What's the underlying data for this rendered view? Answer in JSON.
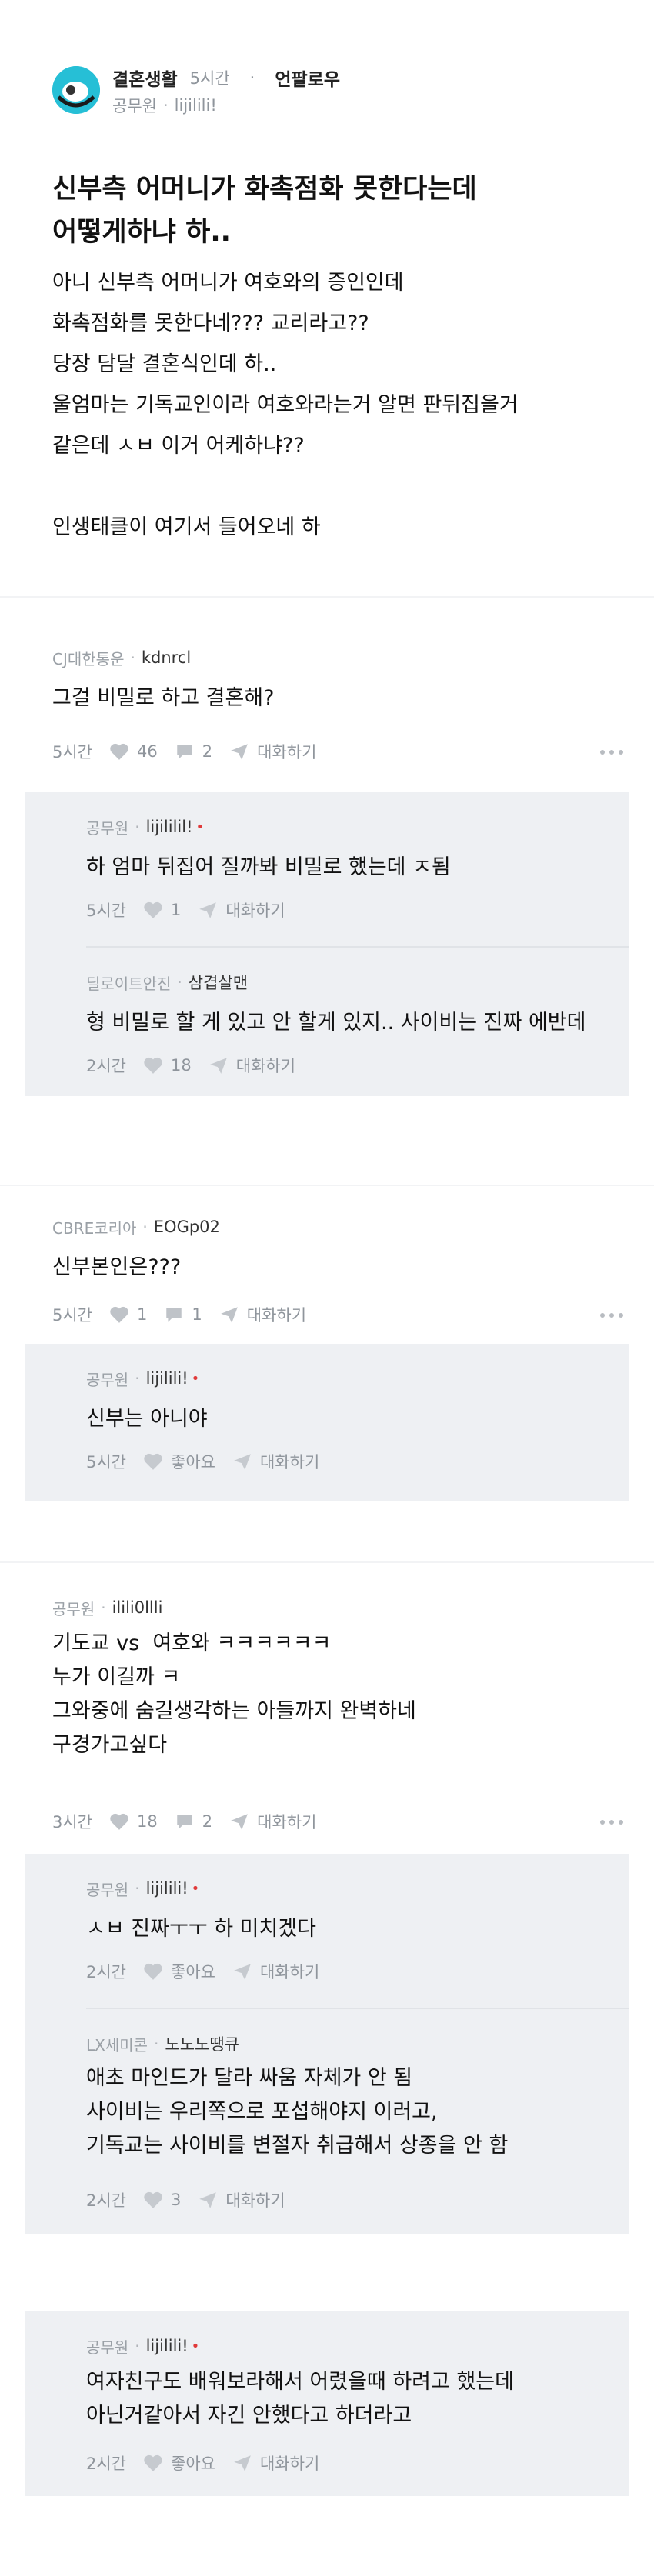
{
  "post": {
    "channel": "결혼생활",
    "time": "5시간",
    "follow_label": "언팔로우",
    "author_company": "공무원",
    "author_name": "lijilili!",
    "title_line1": "신부측 어머니가 화촉점화 못한다는데",
    "title_line2": "어떻게하냐 하..",
    "body_lines": [
      "아니 신부측 어머니가 여호와의 증인인데",
      "화촉점화를 못한다네??? 교리라고??",
      "당장 담달 결혼식인데 하..",
      "울엄마는 기독교인이라 여호와라는거 알면 판뒤집을거",
      "같은데 ㅅㅂ 이거 어케하냐??",
      "",
      "인생태클이 여기서 들어오네 하"
    ]
  },
  "comments": [
    {
      "company": "CJ대한통운",
      "name": "kdnrcl",
      "lines": [
        "그걸 비밀로 하고 결혼해?"
      ],
      "time": "5시간",
      "likes": "46",
      "replies": "2",
      "chat_label": "대화하기",
      "replies_list": [
        {
          "company": "공무원",
          "name": "lijililil!",
          "op": true,
          "lines": [
            "하 엄마 뒤집어 질까봐 비밀로 했는데 ㅈ됨"
          ],
          "time": "5시간",
          "likes": "1",
          "chat_label": "대화하기"
        },
        {
          "company": "딜로이트안진",
          "name": "삼겹살맨",
          "op": false,
          "lines": [
            "형 비밀로 할 게 있고 안 할게 있지.. 사이비는 진짜 에반데"
          ],
          "time": "2시간",
          "likes": "18",
          "chat_label": "대화하기"
        }
      ]
    },
    {
      "company": "CBRE코리아",
      "name": "EOGp02",
      "lines": [
        "신부본인은???"
      ],
      "time": "5시간",
      "likes": "1",
      "replies": "1",
      "chat_label": "대화하기",
      "replies_list": [
        {
          "company": "공무원",
          "name": "lijilili!",
          "op": true,
          "lines": [
            "신부는 아니야"
          ],
          "time": "5시간",
          "likes": "좋아요",
          "chat_label": "대화하기"
        }
      ]
    },
    {
      "company": "공무원",
      "name": "ilili0llli",
      "lines": [
        "기도교 vs  여호와 ㅋㅋㅋㅋㅋㅋ",
        "누가 이길까 ㅋ",
        "",
        "그와중에 숨길생각하는 아들까지 완벽하네",
        "구경가고싶다"
      ],
      "time": "3시간",
      "likes": "18",
      "replies": "2",
      "chat_label": "대화하기",
      "replies_list": [
        {
          "company": "공무원",
          "name": "lijilili!",
          "op": true,
          "lines": [
            "ㅅㅂ 진짜ㅜㅜ 하 미치겠다"
          ],
          "time": "2시간",
          "likes": "좋아요",
          "chat_label": "대화하기"
        },
        {
          "company": "LX세미콘",
          "name": "노노노땡큐",
          "op": false,
          "lines": [
            "애초 마인드가 달라 싸움 자체가 안 됨",
            "사이비는 우리쪽으로 포섭해야지 이러고,",
            "기독교는 사이비를 변절자 취급해서 상종을 안 함"
          ],
          "time": "2시간",
          "likes": "3",
          "chat_label": "대화하기"
        }
      ]
    }
  ],
  "orphan_reply": {
    "company": "공무원",
    "name": "lijilili!",
    "op": true,
    "lines": [
      "여자친구도 배워보라해서 어렸을때 하려고 했는데",
      "아닌거같아서 자긴 안했다고 하더라고"
    ],
    "time": "2시간",
    "likes": "좋아요",
    "chat_label": "대화하기"
  },
  "icons": [
    "heart-icon",
    "comment-icon",
    "paper-plane-icon",
    "more-icon",
    "avatar-icon"
  ]
}
